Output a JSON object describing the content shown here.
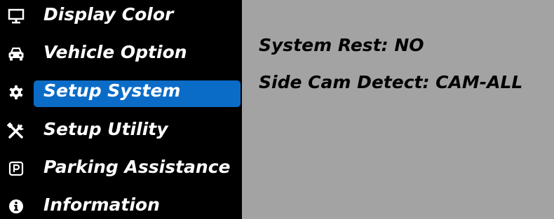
{
  "menu": {
    "items": [
      {
        "label": "Display Color",
        "icon": "monitor-icon"
      },
      {
        "label": "Vehicle Option",
        "icon": "car-icon"
      },
      {
        "label": "Setup System",
        "icon": "gear-icon",
        "selected": true
      },
      {
        "label": "Setup Utility",
        "icon": "tools-icon"
      },
      {
        "label": "Parking Assistance",
        "icon": "parking-icon"
      },
      {
        "label": "Information",
        "icon": "info-icon"
      }
    ]
  },
  "settings": {
    "system_reset": "System Rest: NO",
    "side_cam_detect": "Side Cam Detect: CAM-ALL"
  },
  "colors": {
    "sidebar_bg": "#000000",
    "highlight": "#0b6cc8",
    "panel_bg": "#a3a3a3"
  }
}
